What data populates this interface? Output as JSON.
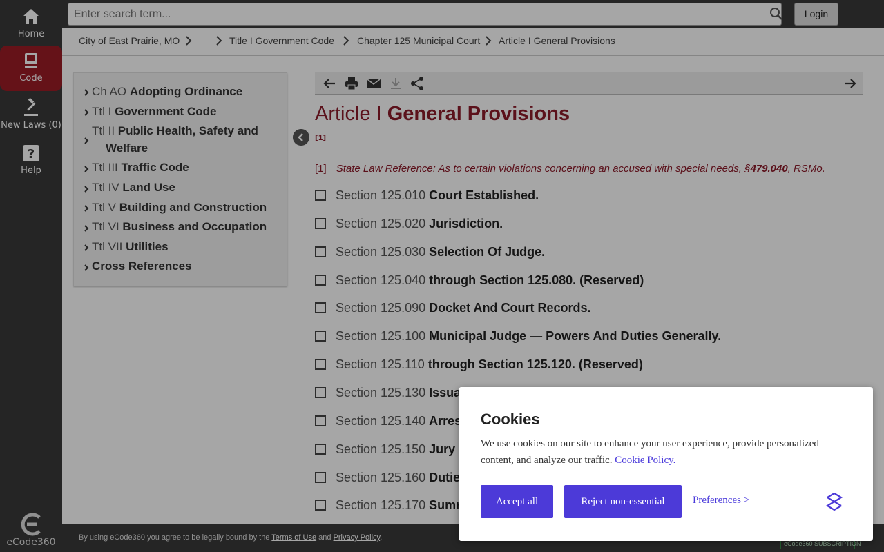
{
  "nav": {
    "home": "Home",
    "code": "Code",
    "new_laws": "New Laws (0)",
    "help": "Help",
    "logo": "eCode360"
  },
  "search": {
    "placeholder": "Enter search term..."
  },
  "login": "Login",
  "breadcrumb": [
    "City of East Prairie, MO",
    "Title I Government Code",
    "Chapter 125 Municipal Court",
    "Article I General Provisions"
  ],
  "toc": [
    {
      "num": "Ch AO",
      "name": "Adopting Ordinance"
    },
    {
      "num": "Ttl I",
      "name": "Government Code"
    },
    {
      "num": "Ttl II",
      "name": "Public Health, Safety and",
      "name2": "Welfare"
    },
    {
      "num": "Ttl III",
      "name": "Traffic Code"
    },
    {
      "num": "Ttl IV",
      "name": "Land Use"
    },
    {
      "num": "Ttl V",
      "name": "Building and Construction"
    },
    {
      "num": "Ttl VI",
      "name": "Business and Occupation"
    },
    {
      "num": "Ttl VII",
      "name": "Utilities"
    },
    {
      "num": "",
      "name": "Cross References"
    }
  ],
  "article": {
    "prefix": "Article I",
    "title": "General Provisions",
    "fnref": "[1]",
    "footnote_mark": "[1]",
    "footnote_text": "State Law Reference: As to certain violations concerning an accused with special needs, §",
    "footnote_bold": "479.040",
    "footnote_tail": ", RSMo."
  },
  "sections": [
    {
      "num": "Section 125.010",
      "title": "Court Established."
    },
    {
      "num": "Section 125.020",
      "title": "Jurisdiction."
    },
    {
      "num": "Section 125.030",
      "title": "Selection Of Judge."
    },
    {
      "num": "Section 125.040",
      "title": "through Section 125.080. (Reserved)"
    },
    {
      "num": "Section 125.090",
      "title": "Docket And Court Records."
    },
    {
      "num": "Section 125.100",
      "title": "Municipal Judge — Powers And Duties Generally."
    },
    {
      "num": "Section 125.110",
      "title": "through Section 125.120. (Reserved)"
    },
    {
      "num": "Section 125.130",
      "title": "Issua"
    },
    {
      "num": "Section 125.140",
      "title": "Arres"
    },
    {
      "num": "Section 125.150",
      "title": "Jury"
    },
    {
      "num": "Section 125.160",
      "title": "Dutie"
    },
    {
      "num": "Section 125.170",
      "title": "Sumr"
    }
  ],
  "footer": {
    "pre": "By using eCode360 you agree to be legally bound by the ",
    "terms": "Terms of Use",
    "and": " and ",
    "privacy": "Privacy Policy",
    "post": ".",
    "badge": "eCode360  SUBSCRIPTION"
  },
  "cookie": {
    "title": "Cookies",
    "text": "We use cookies on our site to enhance your user experience, provide personalized content, and analyze our traffic. ",
    "policy_link": "Cookie Policy.",
    "accept": "Accept all",
    "reject": "Reject non-essential",
    "preferences": "Preferences",
    "preferences_arrow": " >"
  },
  "colors": {
    "accent": "#9c1c26",
    "title": "#8c1b2a",
    "button": "#4c3ad8",
    "dark": "#3a3a3a"
  }
}
